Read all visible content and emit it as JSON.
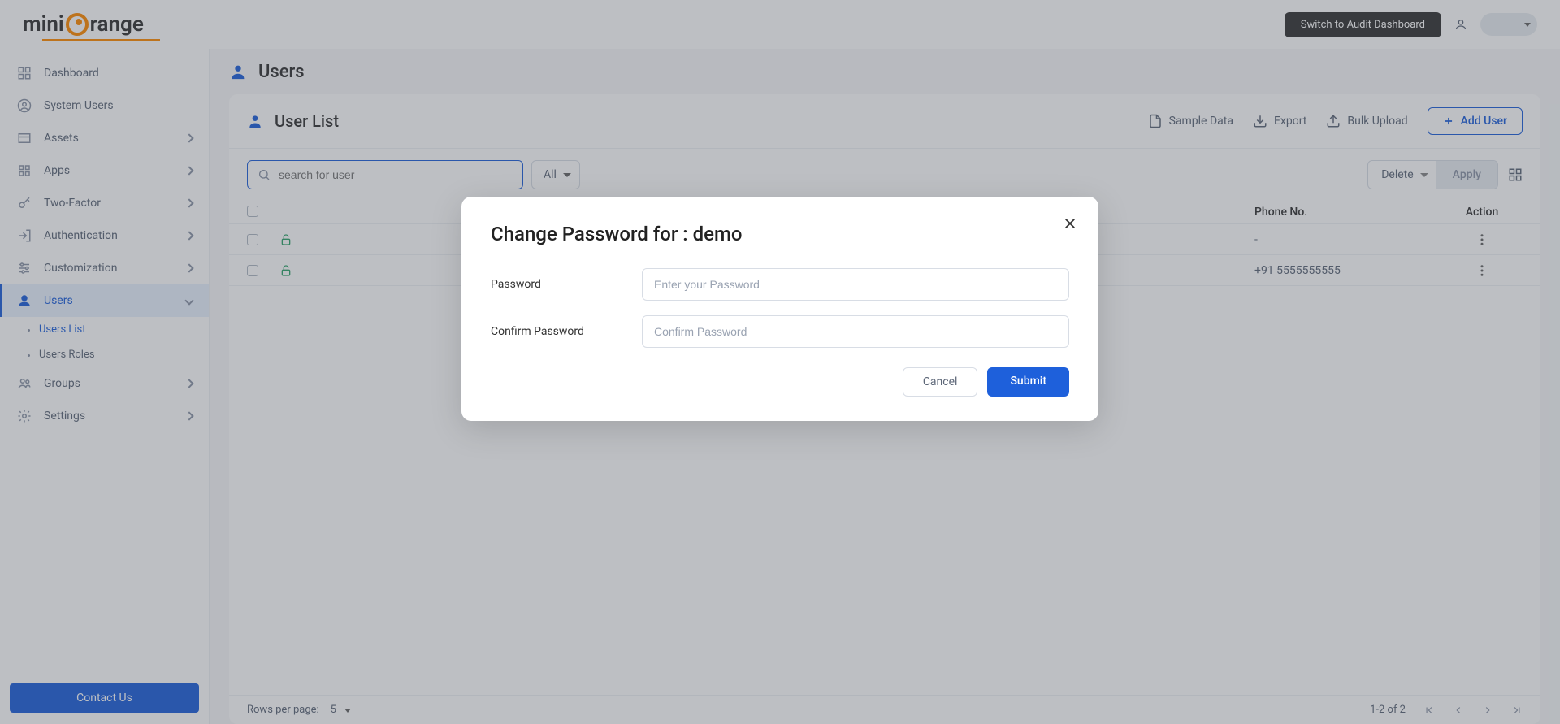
{
  "brand": {
    "part1": "mini",
    "part2": "range"
  },
  "topbar": {
    "switch_label": "Switch to Audit Dashboard"
  },
  "sidebar": {
    "items": [
      {
        "label": "Dashboard"
      },
      {
        "label": "System Users"
      },
      {
        "label": "Assets"
      },
      {
        "label": "Apps"
      },
      {
        "label": "Two-Factor"
      },
      {
        "label": "Authentication"
      },
      {
        "label": "Customization"
      },
      {
        "label": "Users"
      },
      {
        "label": "Groups"
      },
      {
        "label": "Settings"
      }
    ],
    "users_sub": [
      {
        "label": "Users List"
      },
      {
        "label": "Users Roles"
      }
    ],
    "contact_us": "Contact Us"
  },
  "page": {
    "title": "Users",
    "panel_title": "User List",
    "actions": {
      "sample_data": "Sample Data",
      "export": "Export",
      "bulk_upload": "Bulk Upload",
      "add_user": "Add User"
    },
    "search_placeholder": "search for user",
    "filter_all": "All",
    "bulk": {
      "delete": "Delete",
      "apply": "Apply"
    },
    "columns": {
      "phone": "Phone No.",
      "action": "Action"
    },
    "rows": [
      {
        "phone": "-"
      },
      {
        "phone": "+91 5555555555"
      }
    ],
    "footer": {
      "rows_per_page_label": "Rows per page:",
      "rows_per_page_value": "5",
      "range": "1-2 of 2"
    }
  },
  "modal": {
    "title": "Change Password for : demo",
    "password_label": "Password",
    "password_placeholder": "Enter your Password",
    "confirm_label": "Confirm Password",
    "confirm_placeholder": "Confirm Password",
    "cancel": "Cancel",
    "submit": "Submit"
  }
}
